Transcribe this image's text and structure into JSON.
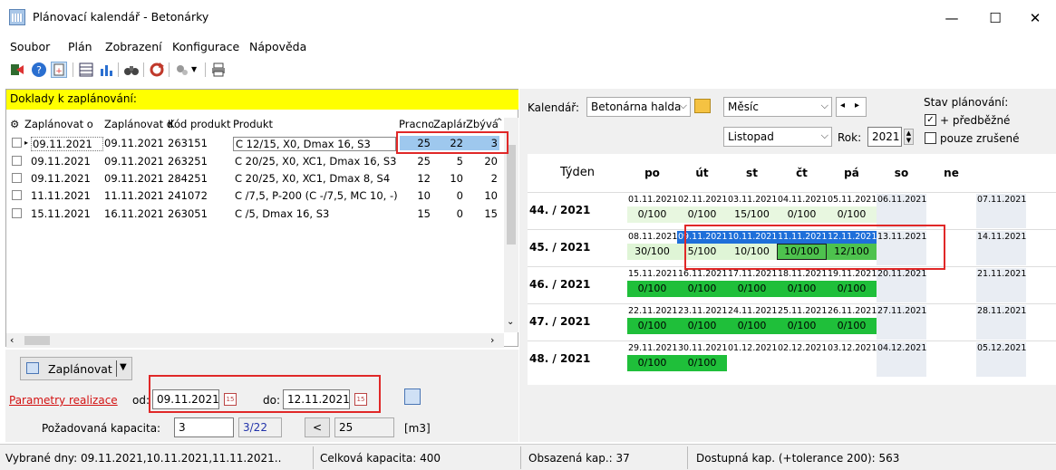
{
  "window": {
    "title": "Plánovací kalendář - Betonárky",
    "minimize": "—",
    "maximize": "☐",
    "close": "✕"
  },
  "menu": [
    "Soubor",
    "Plán",
    "Zobrazení",
    "Konfigurace",
    "Nápověda"
  ],
  "left": {
    "header": "Doklady k zaplánování:",
    "columns": [
      "Zaplánovat o",
      "Zaplánovat d",
      "Kód produkt",
      "Produkt",
      "Pracno",
      "Zaplán",
      "Zbývá"
    ],
    "rows": [
      {
        "from": "09.11.2021",
        "to": "09.11.2021",
        "code": "263151",
        "product": "C 12/15, X0, Dmax 16, S3",
        "work": "25",
        "planned": "22",
        "rest": "3"
      },
      {
        "from": "09.11.2021",
        "to": "09.11.2021",
        "code": "263251",
        "product": "C 20/25, X0, XC1, Dmax 16, S3",
        "work": "25",
        "planned": "5",
        "rest": "20"
      },
      {
        "from": "09.11.2021",
        "to": "09.11.2021",
        "code": "284251",
        "product": "C 20/25, X0, XC1, Dmax 8, S4",
        "work": "12",
        "planned": "10",
        "rest": "2"
      },
      {
        "from": "11.11.2021",
        "to": "11.11.2021",
        "code": "241072",
        "product": "C /7,5, P-200 (C -/7,5, MC 10, -)",
        "work": "10",
        "planned": "0",
        "rest": "10"
      },
      {
        "from": "15.11.2021",
        "to": "16.11.2021",
        "code": "263051",
        "product": "C /5, Dmax 16, S3",
        "work": "15",
        "planned": "0",
        "rest": "15"
      }
    ],
    "plan_button": "Zaplánovat",
    "params_link": "Parametry realizace",
    "od_label": "od:",
    "od_value": "09.11.2021",
    "do_label": "do:",
    "do_value": "12.11.2021",
    "capacity_label": "Požadovaná kapacita:",
    "capacity_value": "3",
    "capacity_ratio": "3/22",
    "lt": "<",
    "capacity_max": "25",
    "unit": "[m3]"
  },
  "right": {
    "kalendar_label": "Kalendář:",
    "kalendar_value": "Betonárna halda",
    "view_value": "Měsíc",
    "month_value": "Listopad",
    "rok_label": "Rok:",
    "rok_value": "2021",
    "stav_label": "Stav plánování:",
    "check1": "+ předběžné",
    "check2": "pouze zrušené",
    "nav_left": "◂",
    "nav_right": "▸"
  },
  "calendar": {
    "headers": [
      "Týden",
      "po",
      "út",
      "st",
      "čt",
      "pá",
      "so",
      "ne"
    ],
    "weeks": [
      {
        "label": "44. / 2021",
        "days": [
          [
            "01.11.2021",
            "0/100"
          ],
          [
            "02.11.2021",
            "0/100"
          ],
          [
            "03.11.2021",
            "15/100"
          ],
          [
            "04.11.2021",
            "0/100"
          ],
          [
            "05.11.2021",
            "0/100"
          ],
          [
            "06.11.2021",
            ""
          ],
          [
            "07.11.2021",
            ""
          ]
        ]
      },
      {
        "label": "45. / 2021",
        "days": [
          [
            "08.11.2021",
            "30/100"
          ],
          [
            "09.11.2021",
            "5/100"
          ],
          [
            "10.11.2021",
            "10/100"
          ],
          [
            "11.11.2021",
            "10/100"
          ],
          [
            "12.11.2021",
            "12/100"
          ],
          [
            "13.11.2021",
            ""
          ],
          [
            "14.11.2021",
            ""
          ]
        ]
      },
      {
        "label": "46. / 2021",
        "days": [
          [
            "15.11.2021",
            "0/100"
          ],
          [
            "16.11.2021",
            "0/100"
          ],
          [
            "17.11.2021",
            "0/100"
          ],
          [
            "18.11.2021",
            "0/100"
          ],
          [
            "19.11.2021",
            "0/100"
          ],
          [
            "20.11.2021",
            ""
          ],
          [
            "21.11.2021",
            ""
          ]
        ]
      },
      {
        "label": "47. / 2021",
        "days": [
          [
            "22.11.2021",
            "0/100"
          ],
          [
            "23.11.2021",
            "0/100"
          ],
          [
            "24.11.2021",
            "0/100"
          ],
          [
            "25.11.2021",
            "0/100"
          ],
          [
            "26.11.2021",
            "0/100"
          ],
          [
            "27.11.2021",
            ""
          ],
          [
            "28.11.2021",
            ""
          ]
        ]
      },
      {
        "label": "48. / 2021",
        "days": [
          [
            "29.11.2021",
            "0/100"
          ],
          [
            "30.11.2021",
            "0/100"
          ],
          [
            "01.12.2021",
            ""
          ],
          [
            "02.12.2021",
            ""
          ],
          [
            "03.12.2021",
            ""
          ],
          [
            "04.12.2021",
            ""
          ],
          [
            "05.12.2021",
            ""
          ]
        ]
      }
    ]
  },
  "status": {
    "selected": "Vybrané dny: 09.11.2021,10.11.2021,11.11.2021..",
    "total": "Celková kapacita: 400",
    "used": "Obsazená kap.: 37",
    "available": "Dostupná kap. (+tolerance 200): 563"
  }
}
